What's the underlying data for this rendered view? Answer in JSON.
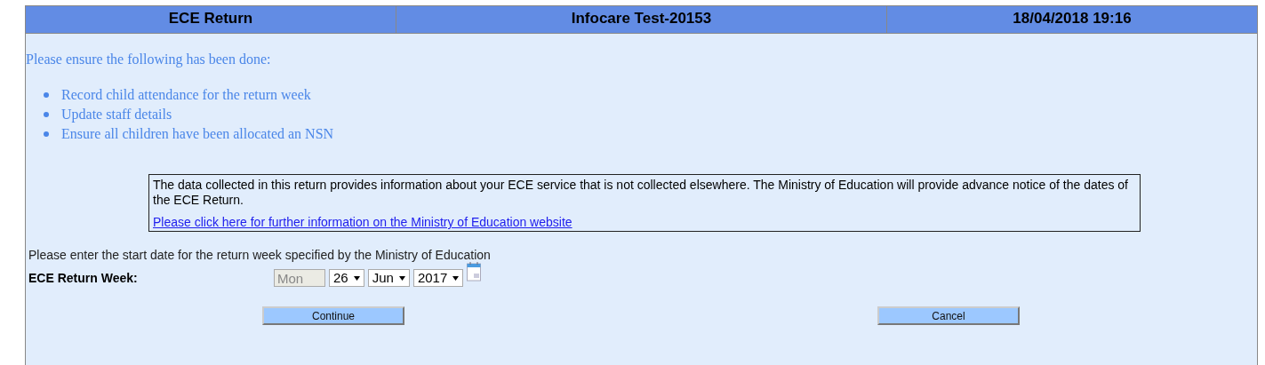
{
  "header": {
    "title": "ECE Return",
    "centre": "Infocare Test-20153",
    "datetime": "18/04/2018 19:16"
  },
  "intro": "Please ensure the following has been done:",
  "checklist": [
    "Record child attendance for the return week",
    "Update staff details",
    "Ensure all children have been allocated an NSN"
  ],
  "notice": {
    "text": "The data collected in this return provides information about your ECE service that is not collected elsewhere. The Ministry of Education will provide advance notice of the dates of the ECE Return.",
    "link": "Please click here for further information on the Ministry of Education website"
  },
  "prompt": "Please enter the start date for the return week specified by the Ministry of Education",
  "week": {
    "label": "ECE Return Week:",
    "weekday": "Mon",
    "day": "26",
    "month": "Jun",
    "year": "2017"
  },
  "buttons": [
    "Continue",
    "Cancel"
  ]
}
